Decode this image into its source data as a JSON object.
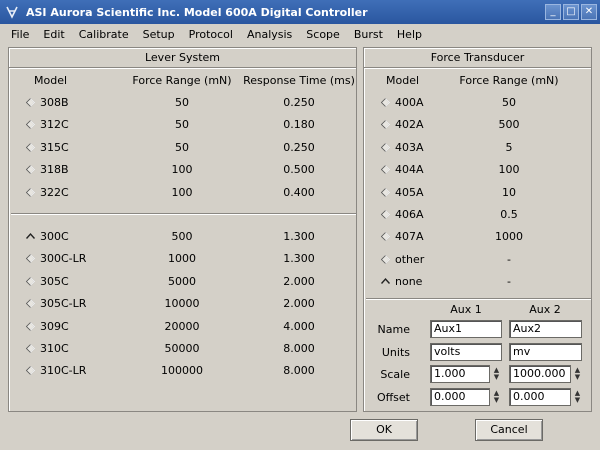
{
  "window": {
    "title": "ASI Aurora Scientific Inc.  Model 600A Digital Controller",
    "app_icon": "app-icon",
    "controls": [
      "minimize",
      "maximize",
      "close"
    ]
  },
  "menu": [
    "File",
    "Edit",
    "Calibrate",
    "Setup",
    "Protocol",
    "Analysis",
    "Scope",
    "Burst",
    "Help"
  ],
  "lever_system": {
    "title": "Lever System",
    "headers": {
      "model": "Model",
      "force_range": "Force Range (mN)",
      "response_time": "Response Time (ms)"
    },
    "group1": [
      {
        "model": "308B",
        "force": "50",
        "time": "0.250",
        "selected": false
      },
      {
        "model": "312C",
        "force": "50",
        "time": "0.180",
        "selected": false
      },
      {
        "model": "315C",
        "force": "50",
        "time": "0.250",
        "selected": false
      },
      {
        "model": "318B",
        "force": "100",
        "time": "0.500",
        "selected": false
      },
      {
        "model": "322C",
        "force": "100",
        "time": "0.400",
        "selected": false
      }
    ],
    "group2": [
      {
        "model": "300C",
        "force": "500",
        "time": "1.300",
        "selected": true
      },
      {
        "model": "300C-LR",
        "force": "1000",
        "time": "1.300",
        "selected": false
      },
      {
        "model": "305C",
        "force": "5000",
        "time": "2.000",
        "selected": false
      },
      {
        "model": "305C-LR",
        "force": "10000",
        "time": "2.000",
        "selected": false
      },
      {
        "model": "309C",
        "force": "20000",
        "time": "4.000",
        "selected": false
      },
      {
        "model": "310C",
        "force": "50000",
        "time": "8.000",
        "selected": false
      },
      {
        "model": "310C-LR",
        "force": "100000",
        "time": "8.000",
        "selected": false
      }
    ]
  },
  "force_transducer": {
    "title": "Force Transducer",
    "headers": {
      "model": "Model",
      "force_range": "Force Range (mN)"
    },
    "rows": [
      {
        "model": "400A",
        "force": "50",
        "selected": false
      },
      {
        "model": "402A",
        "force": "500",
        "selected": false
      },
      {
        "model": "403A",
        "force": "5",
        "selected": false
      },
      {
        "model": "404A",
        "force": "100",
        "selected": false
      },
      {
        "model": "405A",
        "force": "10",
        "selected": false
      },
      {
        "model": "406A",
        "force": "0.5",
        "selected": false
      },
      {
        "model": "407A",
        "force": "1000",
        "selected": false
      },
      {
        "model": "other",
        "force": "-",
        "selected": false
      },
      {
        "model": "none",
        "force": "-",
        "selected": true
      }
    ]
  },
  "aux": {
    "headers": {
      "aux1": "Aux 1",
      "aux2": "Aux 2"
    },
    "labels": {
      "name": "Name",
      "units": "Units",
      "scale": "Scale",
      "offset": "Offset"
    },
    "aux1": {
      "name": "Aux1",
      "units": "volts",
      "scale": "1.000",
      "offset": "0.000"
    },
    "aux2": {
      "name": "Aux2",
      "units": "mv",
      "scale": "1000.000",
      "offset": "0.000"
    }
  },
  "buttons": {
    "ok": "OK",
    "cancel": "Cancel"
  }
}
